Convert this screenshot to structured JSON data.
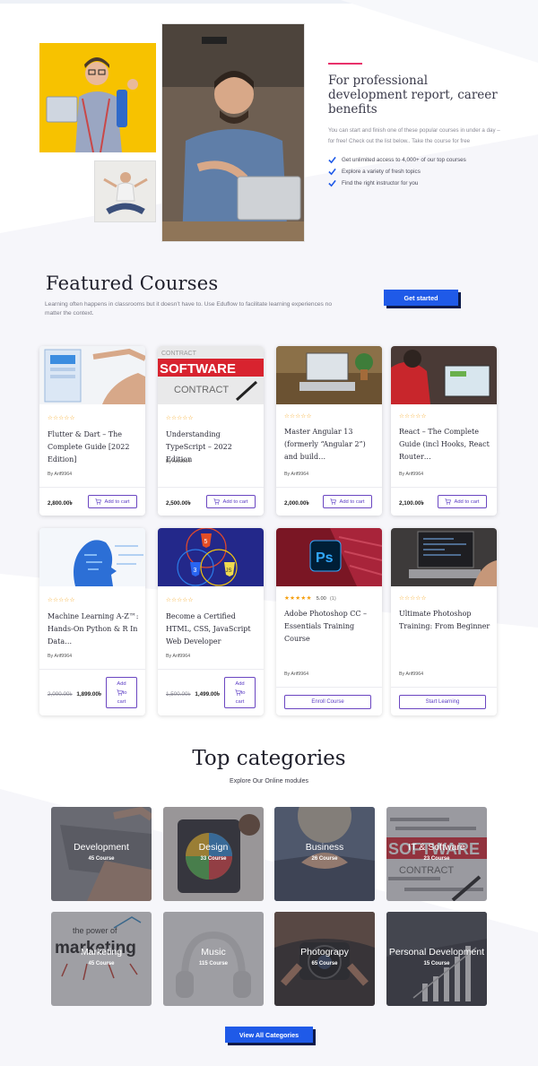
{
  "hero": {
    "title": "For professional development report, career benefits",
    "description": "You can start and finish one of these popular courses in under a day – for free! Check out the list below.. Take the course for free",
    "features": [
      "Get unlimited access to 4,000+ of our top courses",
      "Explore a variety of fresh topics",
      "Find the right instructor for you"
    ],
    "accent_color": "#e8316b",
    "check_color": "#1f5ae8"
  },
  "featured": {
    "title": "Featured Courses",
    "subtitle": "Learning often happens in classrooms but it doesn’t have to. Use Eduflow to facilitate learning experiences no matter the context.",
    "cta_label": "Get started",
    "cta_color": "#1f5ae8"
  },
  "courses": [
    {
      "title": "Flutter & Dart – The Complete Guide [2022 Edition]",
      "stars": "☆☆☆☆☆",
      "author": "By Arif9964",
      "price": "2,800.00৳",
      "action": "Add to cart"
    },
    {
      "title": "Understanding TypeScript – 2022 Edition",
      "stars": "☆☆☆☆☆",
      "author": "By Arif9964",
      "price": "2,500.00৳",
      "action": "Add to cart"
    },
    {
      "title": "Master Angular 13 (formerly “Angular 2”) and build…",
      "stars": "☆☆☆☆☆",
      "author": "By Arif9964",
      "price": "2,000.00৳",
      "action": "Add to cart"
    },
    {
      "title": "React – The Complete Guide (incl Hooks, React Router…",
      "stars": "☆☆☆☆☆",
      "author": "By Arif9964",
      "price": "2,100.00৳",
      "action": "Add to cart"
    },
    {
      "title": "Machine Learning A-Z™: Hands-On Python & R In Data…",
      "stars": "☆☆☆☆☆",
      "author": "By Arif9964",
      "old_price": "2,000.00৳",
      "price": "1,899.00৳",
      "action_lines": [
        "Add",
        "to",
        "cart"
      ]
    },
    {
      "title": "Become a Certified HTML, CSS, JavaScript Web Developer",
      "stars": "☆☆☆☆☆",
      "author": "By Arif9964",
      "old_price": "1,500.00৳",
      "price": "1,499.00৳",
      "action_lines": [
        "Add",
        "to",
        "cart"
      ]
    },
    {
      "title": "Adobe Photoshop CC – Essentials Training Course",
      "stars": "★★★★★",
      "rating": "5.00",
      "rating_count": "(1)",
      "author": "By Arif9964",
      "action": "Enroll Course"
    },
    {
      "title": "Ultimate Photoshop Training: From Beginner",
      "stars": "☆☆☆☆☆",
      "author": "By Arif9964",
      "action": "Start Learning"
    }
  ],
  "categories": {
    "title": "Top categories",
    "subtitle": "Explore Our Online modules",
    "items": [
      {
        "name": "Development",
        "count": "45 Course"
      },
      {
        "name": "Design",
        "count": "33 Course"
      },
      {
        "name": "Business",
        "count": "26 Course"
      },
      {
        "name": "IT & Software",
        "count": "23 Course"
      },
      {
        "name": "Marketing",
        "count": "45 Course"
      },
      {
        "name": "Music",
        "count": "115 Course"
      },
      {
        "name": "Photograpy",
        "count": "65 Course"
      },
      {
        "name": "Personal Development",
        "count": "15 Course"
      }
    ],
    "cta_label": "View All Categories"
  },
  "images": {
    "software_word": "SOFTWARE",
    "contract_word": "CONTRACT",
    "ps_logo": "Ps",
    "html5_badge": "5",
    "css3_badge": "3",
    "js_badge": "JS",
    "marketing_word": "marketing",
    "power_phrase": "the power of"
  },
  "colors": {
    "star_active": "#f59e0b",
    "button_outline": "#6b46c1"
  }
}
